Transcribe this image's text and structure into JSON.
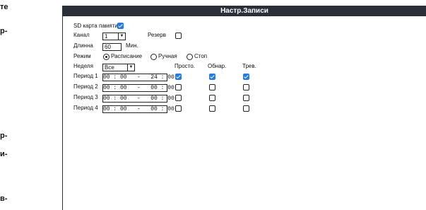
{
  "edge_fragments": [
    "те",
    "р-",
    "р-",
    "и-",
    "в-"
  ],
  "dialog": {
    "title": "Настр.Записи"
  },
  "sd_card": {
    "label": "SD карта памяти",
    "checked": true
  },
  "channel": {
    "label": "Канал",
    "value": "1",
    "arrow": "▼"
  },
  "reserve": {
    "label": "Резерв",
    "checked": false
  },
  "length": {
    "label": "Длинна",
    "value": "60",
    "unit": "Мин."
  },
  "mode": {
    "label": "Режим",
    "options": [
      "Расписание",
      "Ручная",
      "Стоп"
    ],
    "selected": 0
  },
  "week": {
    "label": "Неделя",
    "value": "Все",
    "arrow": "▼"
  },
  "columns": [
    "Просто.",
    "Обнар.",
    "Трев."
  ],
  "periods": [
    {
      "label": "Период 1",
      "time": "00 : 00   -   24 : 00",
      "checks": [
        true,
        true,
        true
      ]
    },
    {
      "label": "Период 2",
      "time": "00 : 00   -   00 : 00",
      "checks": [
        false,
        false,
        false
      ]
    },
    {
      "label": "Период 3",
      "time": "00 : 00   -   00 : 00",
      "checks": [
        false,
        false,
        false
      ]
    },
    {
      "label": "Период 4",
      "time": "00 : 00   -   00 : 00",
      "checks": [
        false,
        false,
        false
      ]
    }
  ],
  "colors": {
    "titlebar": "#2b2f3a",
    "checkbox_checked": "#2a7ae2"
  }
}
